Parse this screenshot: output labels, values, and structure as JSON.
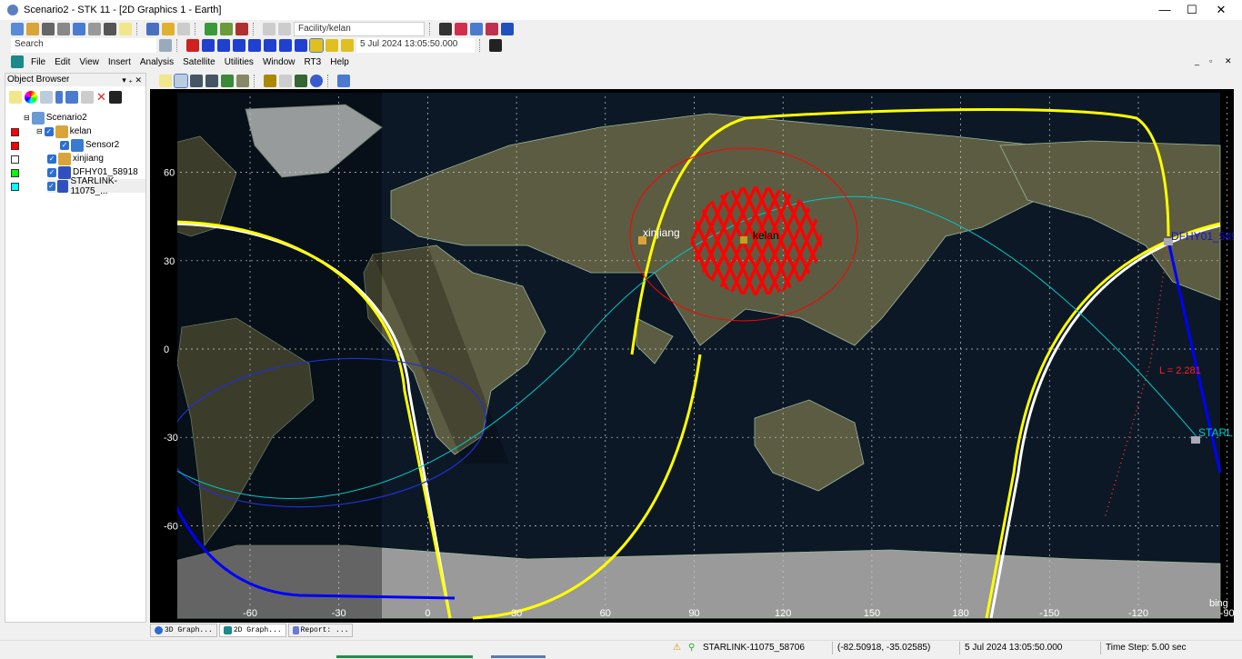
{
  "window": {
    "title": "Scenario2 - STK 11 - [2D Graphics 1 - Earth]"
  },
  "toolbar": {
    "object_select": "Facility/kelan",
    "search_placeholder": "Search",
    "time": "5 Jul 2024 13:05:50.000"
  },
  "menu": [
    "File",
    "Edit",
    "View",
    "Insert",
    "Analysis",
    "Satellite",
    "Utilities",
    "Window",
    "RT3",
    "Help"
  ],
  "object_browser": {
    "title": "Object Browser",
    "items": [
      {
        "label": "Scenario2",
        "icon": "scenario-icon",
        "color": null
      },
      {
        "label": "kelan",
        "icon": "facility-icon",
        "color": "#ff0000"
      },
      {
        "label": "Sensor2",
        "icon": "sensor-icon",
        "color": "#ff0000"
      },
      {
        "label": "xinjiang",
        "icon": "facility-icon",
        "color": "#ffffff"
      },
      {
        "label": "DFHY01_58918",
        "icon": "satellite-icon",
        "color": "#00ff00"
      },
      {
        "label": "STARLINK-11075_...",
        "icon": "satellite-icon",
        "color": "#00ffff"
      }
    ]
  },
  "map": {
    "lat_labels": [
      "60",
      "30",
      "0",
      "-30",
      "-60"
    ],
    "lon_labels": [
      "-60",
      "-30",
      "0",
      "30",
      "60",
      "90",
      "120",
      "150",
      "180",
      "-150",
      "-120",
      "-90"
    ],
    "labels": {
      "xinjiang": "xinjiang",
      "kelan": "kelan",
      "dfhy": "DFHY01_589",
      "starlink": "STARL",
      "distance": "L = 2.281"
    },
    "watermark": "bing",
    "colors": {
      "ground_track": "#ffff00",
      "dfhy": "#0000ff",
      "starlink": "#00c8c8",
      "sensor": "#ff0000"
    }
  },
  "tabs": [
    {
      "label": "3D Graph..."
    },
    {
      "label": "2D Graph..."
    },
    {
      "label": "Report: ..."
    }
  ],
  "status": {
    "object": "STARLINK-11075_58706",
    "position": "(-82.50918, -35.02585)",
    "time": "5 Jul 2024 13:05:50.000",
    "time_step": "Time Step: 5.00 sec"
  }
}
